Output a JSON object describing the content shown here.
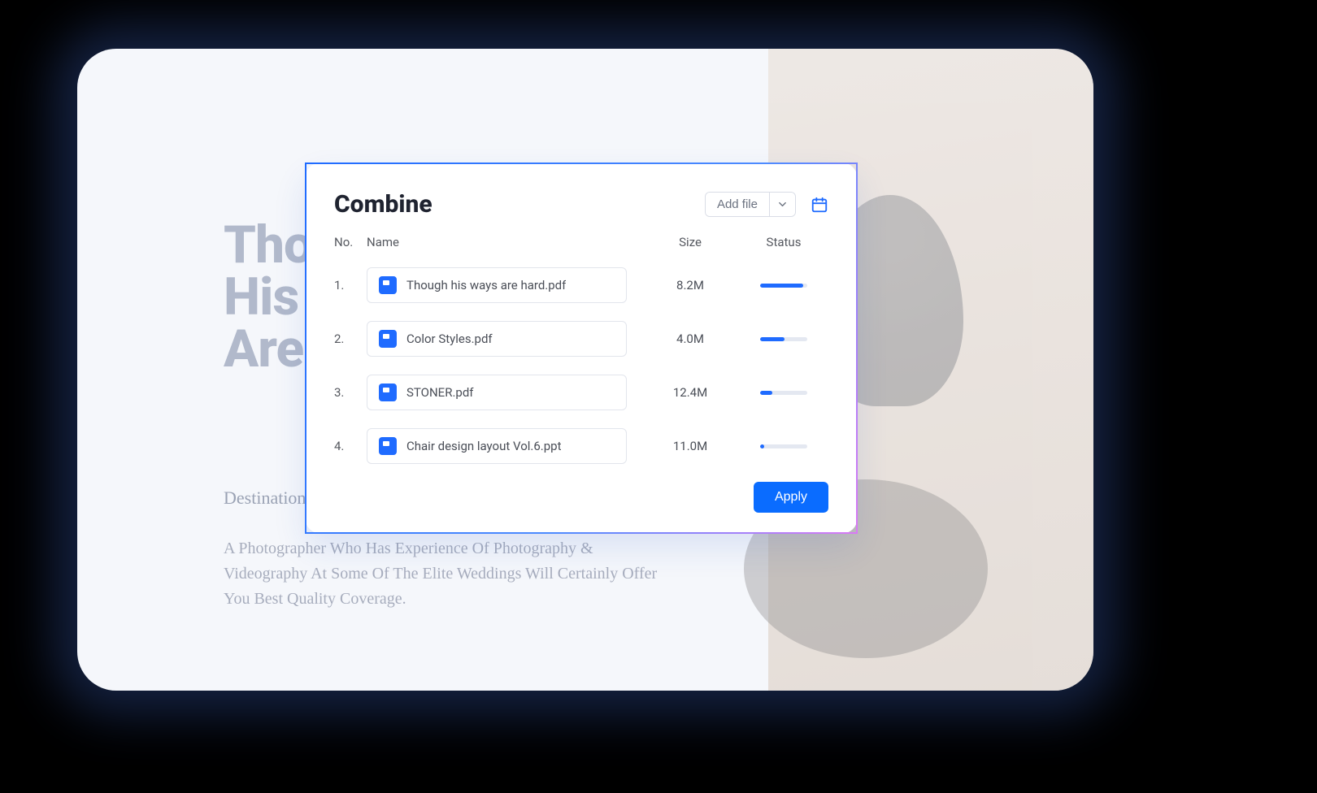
{
  "background": {
    "heading_line1": "Thoug",
    "heading_line2": "His W",
    "heading_line3": "Are H",
    "subtitle": "Destination Weddin",
    "paragraph": "A Photographer Who Has Experience Of Photography & Videography At Some Of The Elite Weddings Will Certainly Offer You Best Quality Coverage."
  },
  "dialog": {
    "title": "Combine",
    "add_file_label": "Add file",
    "apply_label": "Apply",
    "columns": {
      "no": "No.",
      "name": "Name",
      "size": "Size",
      "status": "Status"
    },
    "files": [
      {
        "no": "1.",
        "name": "Though his ways are hard.pdf",
        "size": "8.2M",
        "progress": 92
      },
      {
        "no": "2.",
        "name": "Color Styles.pdf",
        "size": "4.0M",
        "progress": 52
      },
      {
        "no": "3.",
        "name": "STONER.pdf",
        "size": "12.4M",
        "progress": 25
      },
      {
        "no": "4.",
        "name": "Chair design layout Vol.6.ppt",
        "size": "11.0M",
        "progress": 8
      }
    ]
  }
}
